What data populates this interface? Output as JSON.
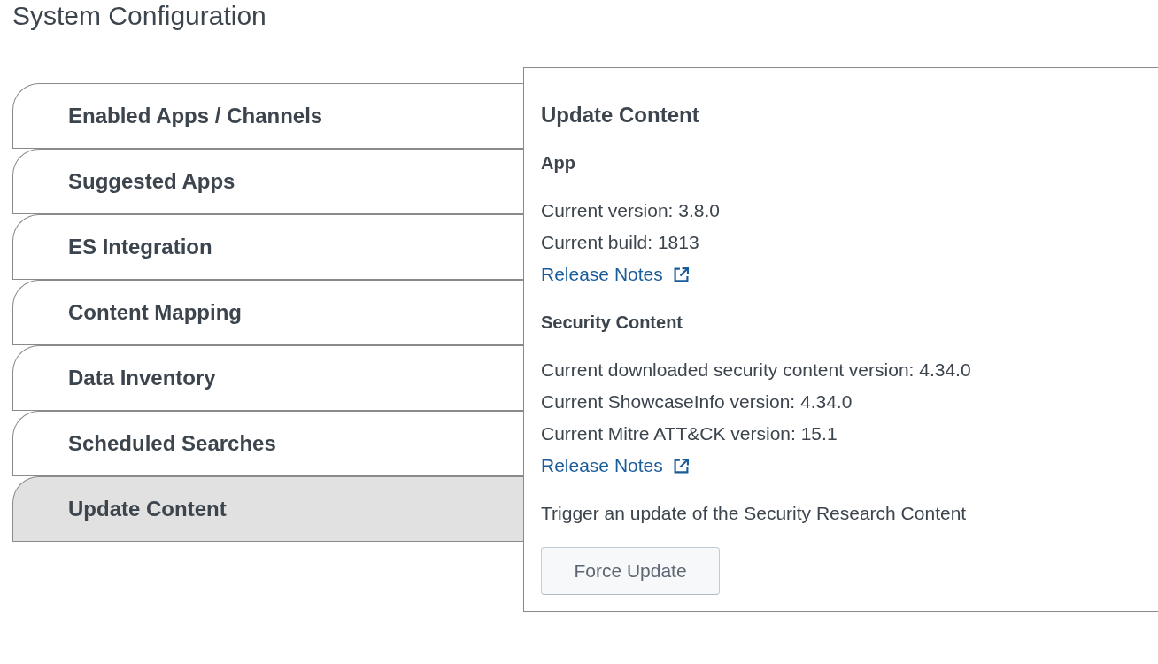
{
  "page": {
    "title": "System Configuration"
  },
  "tabs": [
    {
      "label": "Enabled Apps / Channels",
      "selected": false
    },
    {
      "label": "Suggested Apps",
      "selected": false
    },
    {
      "label": "ES Integration",
      "selected": false
    },
    {
      "label": "Content Mapping",
      "selected": false
    },
    {
      "label": "Data Inventory",
      "selected": false
    },
    {
      "label": "Scheduled Searches",
      "selected": false
    },
    {
      "label": "Update Content",
      "selected": true
    }
  ],
  "panel": {
    "title": "Update Content",
    "sections": [
      {
        "heading": "App",
        "lines": [
          "Current version: 3.8.0",
          "Current build: 1813"
        ],
        "link": "Release Notes"
      },
      {
        "heading": "Security Content",
        "lines": [
          "Current downloaded security content version: 4.34.0",
          "Current ShowcaseInfo version: 4.34.0",
          "Current Mitre ATT&CK version: 15.1"
        ],
        "link": "Release Notes"
      }
    ],
    "trigger_text": "Trigger an update of the Security Research Content",
    "button": "Force Update"
  }
}
